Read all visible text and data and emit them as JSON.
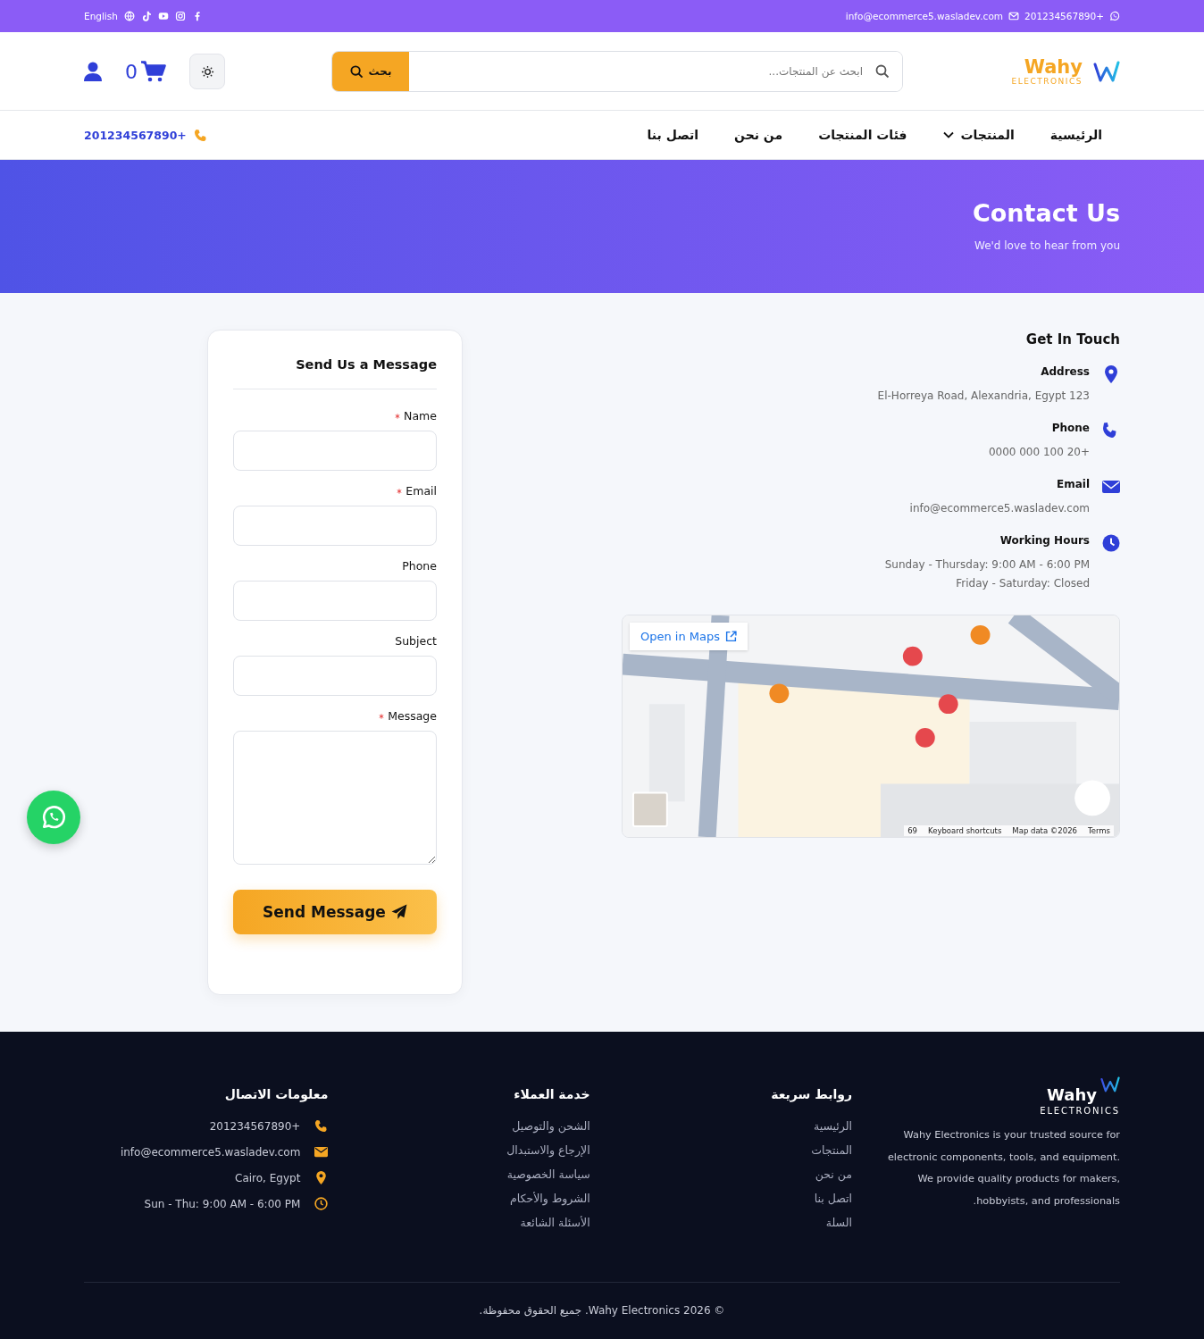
{
  "top_bar": {
    "language": "English",
    "email": "info@ecommerce5.wasladev.com",
    "phone": "201234567890+"
  },
  "header": {
    "logo": {
      "name": "Wahy",
      "tagline": "ELECTRONICS"
    },
    "search": {
      "placeholder": "ابحث عن المنتجات...",
      "button": "بحث"
    },
    "cart_count": "0"
  },
  "nav": {
    "items": [
      {
        "label": "الرئيسية",
        "dropdown": false
      },
      {
        "label": "المنتجات",
        "dropdown": true
      },
      {
        "label": "فئات المنتجات",
        "dropdown": false
      },
      {
        "label": "من نحن",
        "dropdown": false
      },
      {
        "label": "اتصل بنا",
        "dropdown": false
      }
    ],
    "phone": "201234567890+"
  },
  "hero": {
    "title": "Contact Us",
    "subtitle": "We'd love to hear from you"
  },
  "contact": {
    "title": "Get In Touch",
    "items": [
      {
        "kind": "address",
        "label": "Address",
        "lines": [
          "El-Horreya Road, Alexandria, Egypt 123"
        ]
      },
      {
        "kind": "phone",
        "label": "Phone",
        "lines": [
          "0000 000 100 20+"
        ]
      },
      {
        "kind": "email",
        "label": "Email",
        "lines": [
          "info@ecommerce5.wasladev.com"
        ]
      },
      {
        "kind": "hours",
        "label": "Working Hours",
        "lines": [
          "Sunday - Thursday: 9:00 AM - 6:00 PM",
          "Friday - Saturday: Closed"
        ]
      }
    ]
  },
  "map": {
    "link": "Open in Maps",
    "attribution": [
      "Terms",
      "Map data ©2026",
      "Keyboard shortcuts",
      "69"
    ]
  },
  "form": {
    "title": "Send Us a Message",
    "fields": [
      {
        "label": "Name",
        "required": true,
        "kind": "input"
      },
      {
        "label": "Email",
        "required": true,
        "kind": "input"
      },
      {
        "label": "Phone",
        "required": false,
        "kind": "input"
      },
      {
        "label": "Subject",
        "required": false,
        "kind": "input"
      },
      {
        "label": "Message",
        "required": true,
        "kind": "textarea"
      }
    ],
    "submit": "Send Message"
  },
  "footer": {
    "brand": {
      "name": "Wahy",
      "tagline": "ELECTRONICS"
    },
    "about": "Wahy Electronics is your trusted source for electronic components, tools, and equipment. We provide quality products for makers, hobbyists, and professionals.",
    "quick_links": {
      "title": "روابط سريعة",
      "links": [
        "الرئيسية",
        "المنتجات",
        "من نحن",
        "اتصل بنا",
        "السلة"
      ]
    },
    "customer_service": {
      "title": "خدمة العملاء",
      "links": [
        "الشحن والتوصيل",
        "الإرجاع والاستبدال",
        "سياسة الخصوصية",
        "الشروط والأحكام",
        "الأسئلة الشائعة"
      ]
    },
    "contact_info": {
      "title": "معلومات الاتصال",
      "items": [
        {
          "kind": "phone",
          "text": "201234567890+"
        },
        {
          "kind": "email",
          "text": "info@ecommerce5.wasladev.com"
        },
        {
          "kind": "location",
          "text": "Cairo, Egypt"
        },
        {
          "kind": "hours",
          "text": "Sun - Thu: 9:00 AM - 6:00 PM"
        }
      ]
    },
    "copyright": "© 2026 Wahy Electronics. جميع الحقوق محفوظة."
  }
}
